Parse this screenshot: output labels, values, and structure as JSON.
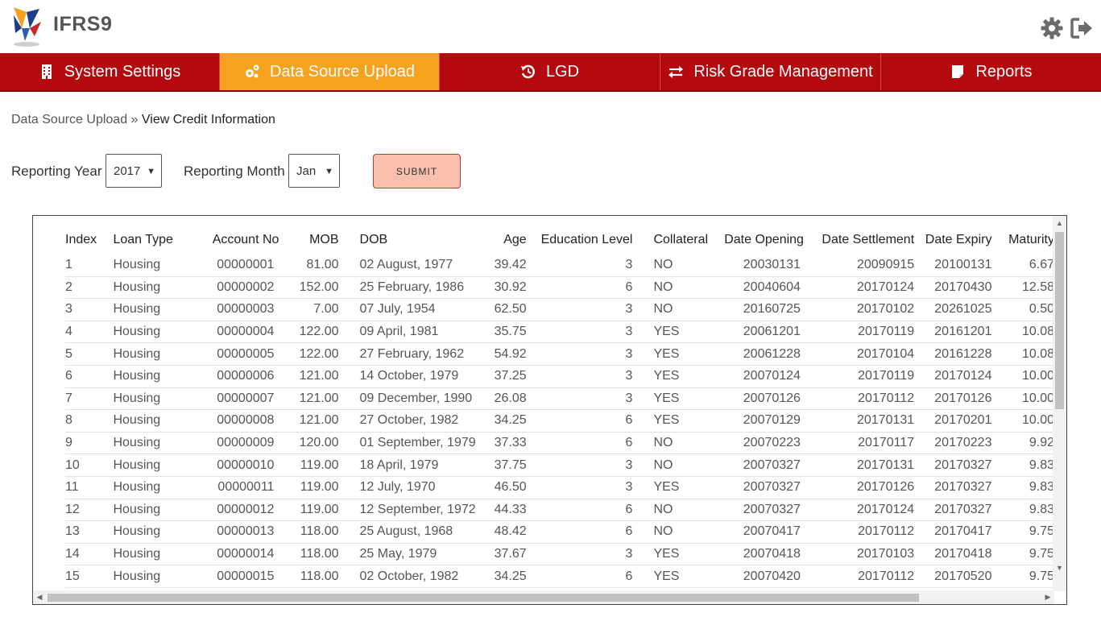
{
  "app": {
    "title": "IFRS9"
  },
  "header": {
    "settings_icon": "gear-icon",
    "logout_icon": "logout-icon"
  },
  "nav": {
    "items": [
      {
        "label": "System Settings",
        "icon": "building-icon",
        "active": false
      },
      {
        "label": "Data Source Upload",
        "icon": "gears-icon",
        "active": true
      },
      {
        "label": "LGD",
        "icon": "history-icon",
        "active": false
      },
      {
        "label": "Risk Grade Management",
        "icon": "exchange-icon",
        "active": false
      },
      {
        "label": "Reports",
        "icon": "sticky-note-icon",
        "active": false
      }
    ]
  },
  "breadcrumb": {
    "parent": "Data Source Upload",
    "separator": "»",
    "current": "View Credit Information"
  },
  "filters": {
    "year_label": "Reporting Year",
    "year_value": "2017",
    "month_label": "Reporting Month",
    "month_value": "Jan",
    "submit_label": "SUBMIT"
  },
  "colors": {
    "nav_bg": "#b3090f",
    "nav_active": "#f6a21e",
    "submit_bg": "#f9bfae"
  },
  "table": {
    "columns": [
      "Index",
      "Loan Type",
      "Account No",
      "MOB",
      "DOB",
      "Age",
      "Education Level",
      "Collateral",
      "Date Opening",
      "Date Settlement",
      "Date Expiry",
      "Maturity"
    ],
    "rows": [
      [
        "1",
        "Housing",
        "00000001",
        "81.00",
        "02 August, 1977",
        "39.42",
        "3",
        "NO",
        "20030131",
        "20090915",
        "20100131",
        "6.67"
      ],
      [
        "2",
        "Housing",
        "00000002",
        "152.00",
        "25 February, 1986",
        "30.92",
        "6",
        "NO",
        "20040604",
        "20170124",
        "20170430",
        "12.58"
      ],
      [
        "3",
        "Housing",
        "00000003",
        "7.00",
        "07 July, 1954",
        "62.50",
        "3",
        "NO",
        "20160725",
        "20170102",
        "20261025",
        "0.50"
      ],
      [
        "4",
        "Housing",
        "00000004",
        "122.00",
        "09 April, 1981",
        "35.75",
        "3",
        "YES",
        "20061201",
        "20170119",
        "20161201",
        "10.08"
      ],
      [
        "5",
        "Housing",
        "00000005",
        "122.00",
        "27 February, 1962",
        "54.92",
        "3",
        "YES",
        "20061228",
        "20170104",
        "20161228",
        "10.08"
      ],
      [
        "6",
        "Housing",
        "00000006",
        "121.00",
        "14 October, 1979",
        "37.25",
        "3",
        "YES",
        "20070124",
        "20170119",
        "20170124",
        "10.00"
      ],
      [
        "7",
        "Housing",
        "00000007",
        "121.00",
        "09 December, 1990",
        "26.08",
        "3",
        "YES",
        "20070126",
        "20170112",
        "20170126",
        "10.00"
      ],
      [
        "8",
        "Housing",
        "00000008",
        "121.00",
        "27 October, 1982",
        "34.25",
        "6",
        "YES",
        "20070129",
        "20170131",
        "20170201",
        "10.00"
      ],
      [
        "9",
        "Housing",
        "00000009",
        "120.00",
        "01 September, 1979",
        "37.33",
        "6",
        "NO",
        "20070223",
        "20170117",
        "20170223",
        "9.92"
      ],
      [
        "10",
        "Housing",
        "00000010",
        "119.00",
        "18 April, 1979",
        "37.75",
        "3",
        "NO",
        "20070327",
        "20170131",
        "20170327",
        "9.83"
      ],
      [
        "11",
        "Housing",
        "00000011",
        "119.00",
        "12 July, 1970",
        "46.50",
        "3",
        "YES",
        "20070327",
        "20170126",
        "20170327",
        "9.83"
      ],
      [
        "12",
        "Housing",
        "00000012",
        "119.00",
        "12 September, 1972",
        "44.33",
        "6",
        "NO",
        "20070327",
        "20170124",
        "20170327",
        "9.83"
      ],
      [
        "13",
        "Housing",
        "00000013",
        "118.00",
        "25 August, 1968",
        "48.42",
        "6",
        "NO",
        "20070417",
        "20170112",
        "20170417",
        "9.75"
      ],
      [
        "14",
        "Housing",
        "00000014",
        "118.00",
        "25 May, 1979",
        "37.67",
        "3",
        "YES",
        "20070418",
        "20170103",
        "20170418",
        "9.75"
      ],
      [
        "15",
        "Housing",
        "00000015",
        "118.00",
        "02 October, 1982",
        "34.25",
        "6",
        "YES",
        "20070420",
        "20170112",
        "20170520",
        "9.75"
      ]
    ]
  }
}
